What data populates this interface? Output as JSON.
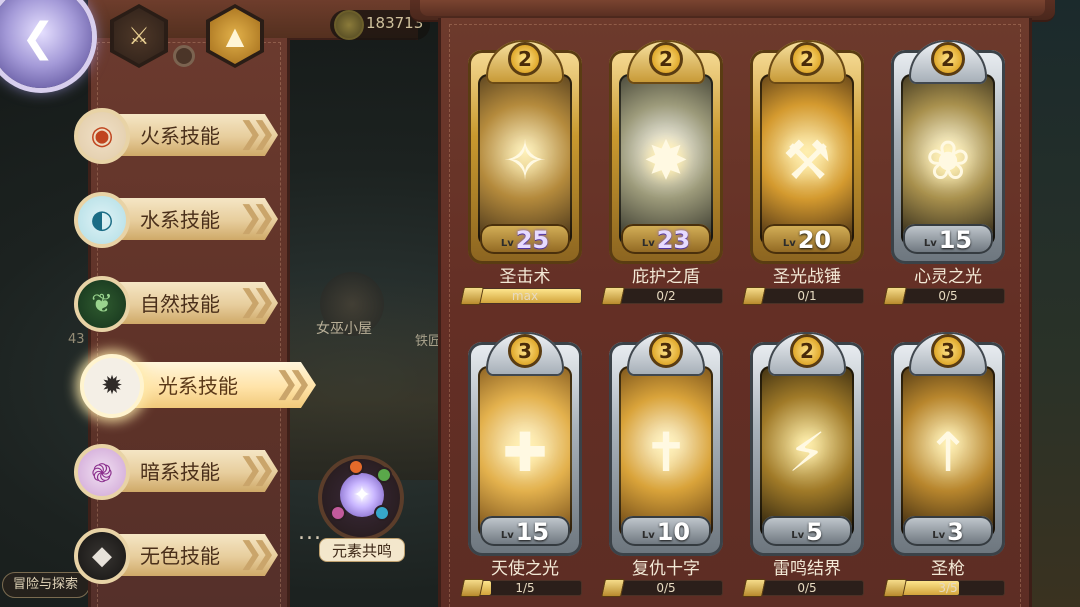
{
  "header": {
    "back_icon": "back-arrow-icon",
    "currency_value": "183713",
    "hex_buttons": [
      {
        "icon": "sword-icon",
        "glyph": "⚔"
      },
      {
        "icon": "triangle-icon",
        "glyph": "▲"
      }
    ]
  },
  "background": {
    "map_label_1": "女巫小屋",
    "map_label_2": "铁匠",
    "map_num": "43",
    "bottom_tab": "冒险与探索"
  },
  "tabs": [
    {
      "label": "火系技能",
      "icon": "fire-element-icon",
      "glyph": "◉",
      "active": false
    },
    {
      "label": "水系技能",
      "icon": "water-element-icon",
      "glyph": "◐",
      "active": false
    },
    {
      "label": "自然技能",
      "icon": "nature-leaf-icon",
      "glyph": "❦",
      "active": false
    },
    {
      "label": "光系技能",
      "icon": "light-sun-icon",
      "glyph": "✹",
      "active": true
    },
    {
      "label": "暗系技能",
      "icon": "dark-vortex-icon",
      "glyph": "֎",
      "active": false
    },
    {
      "label": "无色技能",
      "icon": "colorless-diamond-icon",
      "glyph": "◆",
      "active": false
    }
  ],
  "resonance": {
    "label": "元素共鸣",
    "icon": "element-resonance-icon",
    "glyph": "✦",
    "dots": "..."
  },
  "skills": [
    {
      "name": "圣击术",
      "rank": "2",
      "level": "25",
      "lv_prefix": "Lv",
      "progress_text": "max",
      "progress": 1.0,
      "frame": "gold",
      "level_color": "purple",
      "glyph": "✧",
      "art": [
        "#fff4c8",
        "#b48a3c",
        "#3b2a15"
      ]
    },
    {
      "name": "庇护之盾",
      "rank": "2",
      "level": "23",
      "lv_prefix": "Lv",
      "progress_text": "0/2",
      "progress": 0.0,
      "frame": "gold",
      "level_color": "purple",
      "glyph": "✸",
      "art": [
        "#ffffff",
        "#9c9a7a",
        "#2a2a22"
      ]
    },
    {
      "name": "圣光战锤",
      "rank": "2",
      "level": "20",
      "lv_prefix": "Lv",
      "progress_text": "0/1",
      "progress": 0.0,
      "frame": "gold",
      "level_color": "white",
      "glyph": "⚒",
      "art": [
        "#fff3c0",
        "#d49a2f",
        "#3a2410"
      ]
    },
    {
      "name": "心灵之光",
      "rank": "2",
      "level": "15",
      "lv_prefix": "Lv",
      "progress_text": "0/5",
      "progress": 0.0,
      "frame": "silver",
      "level_color": "white",
      "glyph": "❀",
      "art": [
        "#fffbe2",
        "#a8904d",
        "#1e1a12"
      ]
    },
    {
      "name": "天使之光",
      "rank": "3",
      "level": "15",
      "lv_prefix": "Lv",
      "progress_text": "1/5",
      "progress": 0.2,
      "frame": "silver",
      "level_color": "white",
      "glyph": "✚",
      "art": [
        "#fff8dc",
        "#e3b14d",
        "#6b4414"
      ]
    },
    {
      "name": "复仇十字",
      "rank": "3",
      "level": "10",
      "lv_prefix": "Lv",
      "progress_text": "0/5",
      "progress": 0.0,
      "frame": "silver",
      "level_color": "white",
      "glyph": "✝",
      "art": [
        "#fffbe6",
        "#d9a33a",
        "#5a3811"
      ]
    },
    {
      "name": "雷鸣结界",
      "rank": "2",
      "level": "5",
      "lv_prefix": "Lv",
      "progress_text": "0/5",
      "progress": 0.0,
      "frame": "silver",
      "level_color": "white",
      "glyph": "⚡",
      "art": [
        "#fff0b0",
        "#a07a28",
        "#1b150a"
      ]
    },
    {
      "name": "圣枪",
      "rank": "3",
      "level": "3",
      "lv_prefix": "Lv",
      "progress_text": "3/5",
      "progress": 0.6,
      "frame": "silver",
      "level_color": "white",
      "glyph": "↑",
      "art": [
        "#fff4c4",
        "#b8862d",
        "#2b1d0c"
      ]
    }
  ]
}
